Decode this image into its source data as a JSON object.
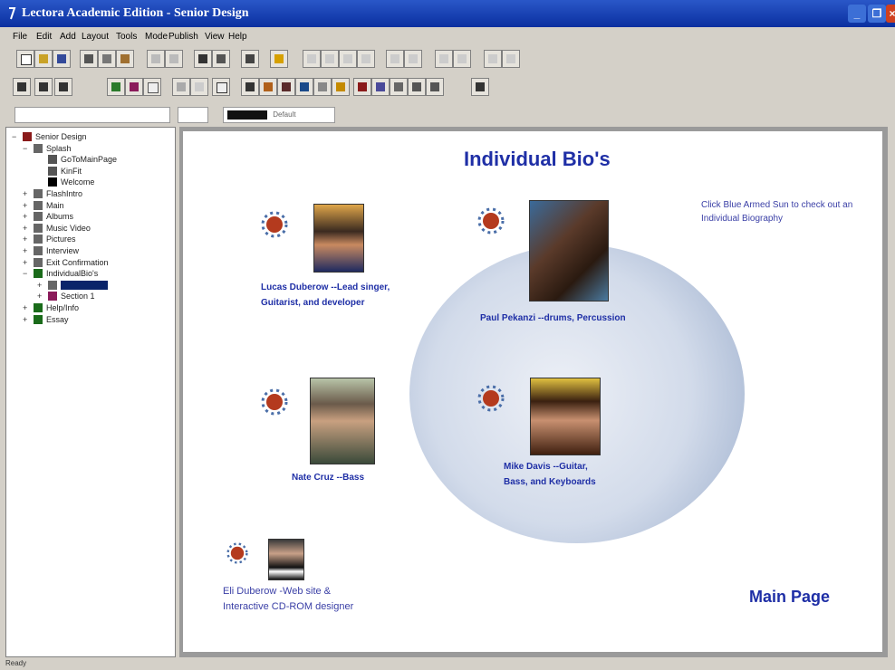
{
  "window": {
    "title": "Lectora Academic Edition - Senior Design"
  },
  "menu": [
    "File",
    "Edit",
    "Add",
    "Layout",
    "Tools",
    "Mode",
    "Publish",
    "View",
    "Help"
  ],
  "combos": {
    "style": "",
    "font": "Default"
  },
  "tree": [
    {
      "label": "Senior Design",
      "exp": "−",
      "icon": "book-icon",
      "color": "#8a1a1a"
    },
    {
      "label": "Splash",
      "exp": "−",
      "icon": "page-icon",
      "color": "#666"
    },
    {
      "label": "GoToMainPage",
      "exp": "",
      "icon": "button-icon",
      "color": "#555"
    },
    {
      "label": "KinFit",
      "exp": "",
      "icon": "button-icon",
      "color": "#555"
    },
    {
      "label": "Welcome",
      "exp": "",
      "icon": "text-icon",
      "color": "#000"
    },
    {
      "label": "FlashIntro",
      "exp": "+",
      "icon": "page-icon",
      "color": "#666"
    },
    {
      "label": "Main",
      "exp": "+",
      "icon": "page-icon",
      "color": "#666"
    },
    {
      "label": "Albums",
      "exp": "+",
      "icon": "page-icon",
      "color": "#666"
    },
    {
      "label": "Music Video",
      "exp": "+",
      "icon": "page-icon",
      "color": "#666"
    },
    {
      "label": "Pictures",
      "exp": "+",
      "icon": "page-icon",
      "color": "#666"
    },
    {
      "label": "Interview",
      "exp": "+",
      "icon": "page-icon",
      "color": "#666"
    },
    {
      "label": "Exit Confirmation",
      "exp": "+",
      "icon": "page-icon",
      "color": "#666"
    },
    {
      "label": "IndividualBio's",
      "exp": "−",
      "icon": "chapter-icon",
      "color": "#1a6b1a"
    },
    {
      "label": "",
      "exp": "+",
      "icon": "page-icon",
      "color": "#666",
      "selected": true
    },
    {
      "label": "Section 1",
      "exp": "+",
      "icon": "section-icon",
      "color": "#8a1a5a"
    },
    {
      "label": "Help/Info",
      "exp": "+",
      "icon": "chapter-icon",
      "color": "#1a6b1a"
    },
    {
      "label": "Essay",
      "exp": "+",
      "icon": "chapter-icon",
      "color": "#1a6b1a"
    }
  ],
  "page": {
    "title": "Individual Bio's",
    "hint": "Click Blue Armed Sun to check out an Individual Biography",
    "main_link": "Main Page",
    "bios": [
      {
        "caption": "Lucas Duberow --Lead singer,\nGuitarist, and developer",
        "photo": "photo-lucas"
      },
      {
        "caption": "Paul Pekanzi --drums, Percussion",
        "photo": "photo-paul"
      },
      {
        "caption": "Nate Cruz --Bass",
        "photo": "photo-nate"
      },
      {
        "caption": "Mike Davis --Guitar,\nBass, and Keyboards",
        "photo": "photo-mike"
      },
      {
        "caption": "Eli Duberow -Web site &\nInteractive CD-ROM designer",
        "photo": "photo-eli"
      }
    ]
  },
  "status": {
    "text": "Ready"
  },
  "colors": {
    "title_blue": "#1f2fa6",
    "titlebar": "#0a2fa0"
  }
}
